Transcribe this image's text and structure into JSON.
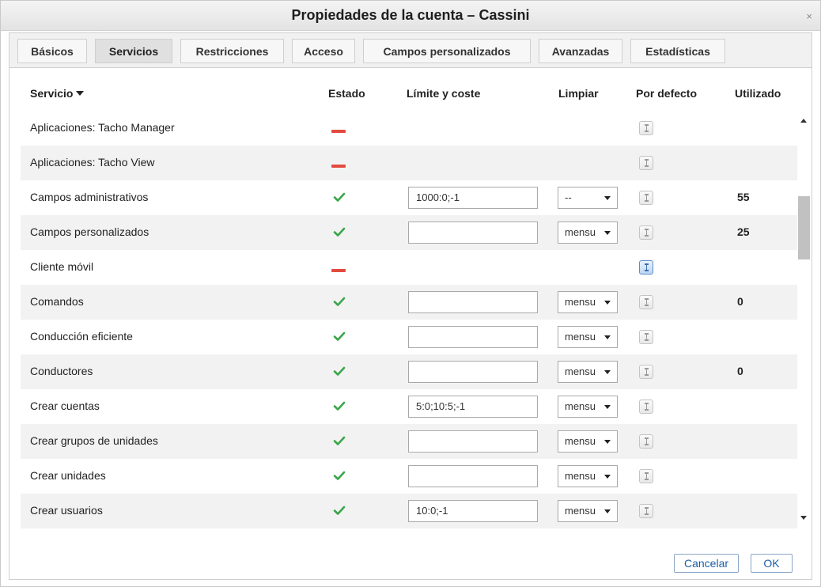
{
  "dialog": {
    "title": "Propiedades de la cuenta – Cassini",
    "close_glyph": "×"
  },
  "tabs": [
    {
      "label": "Básicos",
      "active": false
    },
    {
      "label": "Servicios",
      "active": true
    },
    {
      "label": "Restricciones",
      "active": false
    },
    {
      "label": "Acceso",
      "active": false
    },
    {
      "label": "Campos personalizados",
      "active": false
    },
    {
      "label": "Avanzadas",
      "active": false
    },
    {
      "label": "Estadísticas",
      "active": false
    }
  ],
  "table": {
    "headers": {
      "service": "Servicio",
      "status": "Estado",
      "limit": "Límite y coste",
      "reset": "Limpiar",
      "default": "Por defecto",
      "used": "Utilizado"
    },
    "rows": [
      {
        "name": "Aplicaciones: Tacho Manager",
        "enabled": false,
        "limit": null,
        "reset": null,
        "default_on": false,
        "used": ""
      },
      {
        "name": "Aplicaciones: Tacho View",
        "enabled": false,
        "limit": null,
        "reset": null,
        "default_on": false,
        "used": ""
      },
      {
        "name": "Campos administrativos",
        "enabled": true,
        "limit": "1000:0;-1",
        "reset": "--",
        "default_on": false,
        "used": "55"
      },
      {
        "name": "Campos personalizados",
        "enabled": true,
        "limit": "",
        "reset": "mensu",
        "default_on": false,
        "used": "25"
      },
      {
        "name": "Cliente móvil",
        "enabled": false,
        "limit": null,
        "reset": null,
        "default_on": true,
        "used": ""
      },
      {
        "name": "Comandos",
        "enabled": true,
        "limit": "",
        "reset": "mensu",
        "default_on": false,
        "used": "0"
      },
      {
        "name": "Conducción eficiente",
        "enabled": true,
        "limit": "",
        "reset": "mensu",
        "default_on": false,
        "used": ""
      },
      {
        "name": "Conductores",
        "enabled": true,
        "limit": "",
        "reset": "mensu",
        "default_on": false,
        "used": "0"
      },
      {
        "name": "Crear cuentas",
        "enabled": true,
        "limit": "5:0;10:5;-1",
        "reset": "mensu",
        "default_on": false,
        "used": ""
      },
      {
        "name": "Crear grupos de unidades",
        "enabled": true,
        "limit": "",
        "reset": "mensu",
        "default_on": false,
        "used": ""
      },
      {
        "name": "Crear unidades",
        "enabled": true,
        "limit": "",
        "reset": "mensu",
        "default_on": false,
        "used": ""
      },
      {
        "name": "Crear usuarios",
        "enabled": true,
        "limit": "10:0;-1",
        "reset": "mensu",
        "default_on": false,
        "used": ""
      }
    ]
  },
  "footer": {
    "cancel_label": "Cancelar",
    "ok_label": "OK"
  },
  "icons": {
    "enabled": "check-icon",
    "disabled": "dash-icon",
    "default_toggle": "default-toggle-icon",
    "sort": "sort-down-icon"
  },
  "colors": {
    "check": "#3aa64a",
    "dash": "#e34a3f",
    "button_text": "#1a5ea8",
    "default_on": "#bcd6f3"
  }
}
